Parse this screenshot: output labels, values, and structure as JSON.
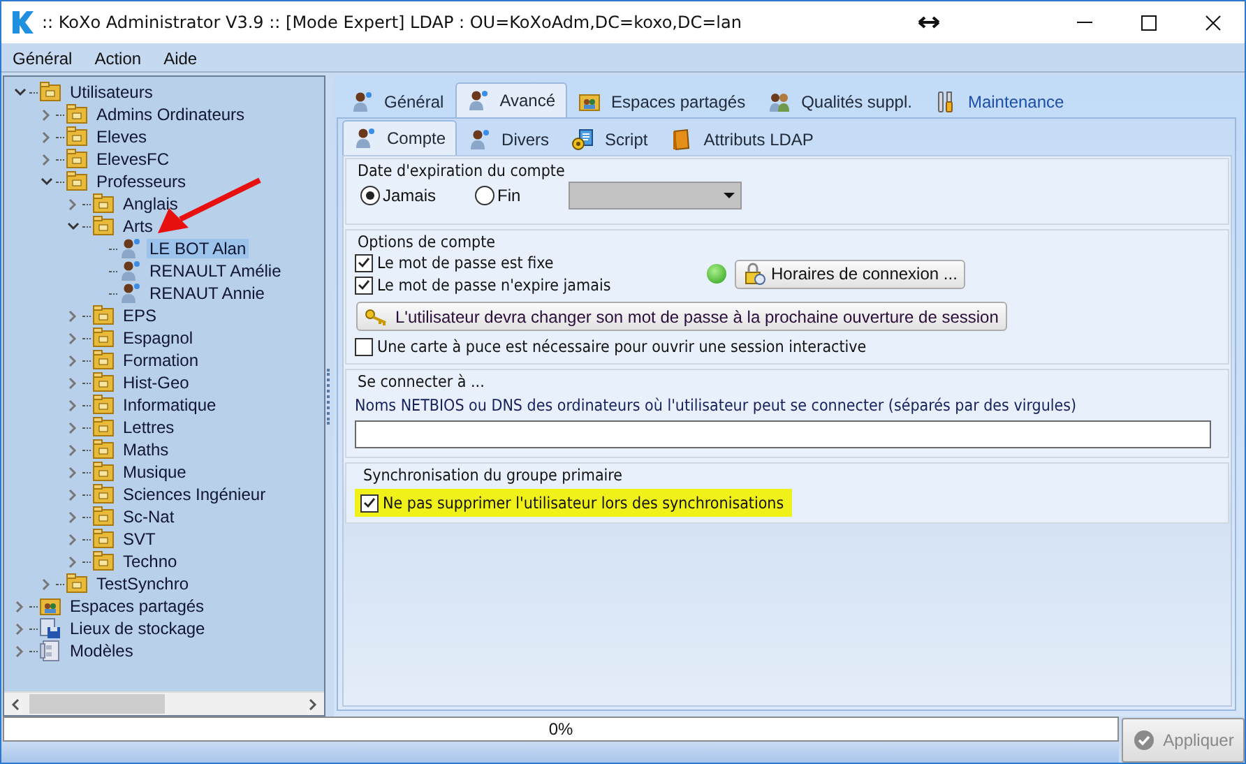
{
  "window": {
    "title": ":: KoXo Administrator V3.9 :: [Mode Expert] LDAP : OU=KoXoAdm,DC=koxo,DC=lan"
  },
  "menu": [
    "Général",
    "Action",
    "Aide"
  ],
  "tree": [
    {
      "label": "Utilisateurs",
      "kind": "folder",
      "expanded": true,
      "selected": false,
      "children": [
        {
          "label": "Admins Ordinateurs",
          "kind": "folder",
          "expanded": false,
          "selected": false
        },
        {
          "label": "Eleves",
          "kind": "folder",
          "expanded": false,
          "selected": false
        },
        {
          "label": "ElevesFC",
          "kind": "folder",
          "expanded": false,
          "selected": false
        },
        {
          "label": "Professeurs",
          "kind": "folder",
          "expanded": true,
          "selected": false,
          "children": [
            {
              "label": "Anglais",
              "kind": "folder",
              "expanded": false,
              "selected": false
            },
            {
              "label": "Arts",
              "kind": "folder",
              "expanded": true,
              "selected": false,
              "children": [
                {
                  "label": "LE BOT Alan",
                  "kind": "user",
                  "selected": true
                },
                {
                  "label": "RENAULT Amélie",
                  "kind": "user",
                  "selected": false
                },
                {
                  "label": "RENAUT Annie",
                  "kind": "user",
                  "selected": false
                }
              ]
            },
            {
              "label": "EPS",
              "kind": "folder",
              "expanded": false,
              "selected": false
            },
            {
              "label": "Espagnol",
              "kind": "folder",
              "expanded": false,
              "selected": false
            },
            {
              "label": "Formation",
              "kind": "folder",
              "expanded": false,
              "selected": false
            },
            {
              "label": "Hist-Geo",
              "kind": "folder",
              "expanded": false,
              "selected": false
            },
            {
              "label": "Informatique",
              "kind": "folder",
              "expanded": false,
              "selected": false
            },
            {
              "label": "Lettres",
              "kind": "folder",
              "expanded": false,
              "selected": false
            },
            {
              "label": "Maths",
              "kind": "folder",
              "expanded": false,
              "selected": false
            },
            {
              "label": "Musique",
              "kind": "folder",
              "expanded": false,
              "selected": false
            },
            {
              "label": "Sciences Ingénieur",
              "kind": "folder",
              "expanded": false,
              "selected": false
            },
            {
              "label": "Sc-Nat",
              "kind": "folder",
              "expanded": false,
              "selected": false
            },
            {
              "label": "SVT",
              "kind": "folder",
              "expanded": false,
              "selected": false
            },
            {
              "label": "Techno",
              "kind": "folder",
              "expanded": false,
              "selected": false
            }
          ]
        },
        {
          "label": "TestSynchro",
          "kind": "folder",
          "expanded": false,
          "selected": false
        }
      ]
    },
    {
      "label": "Espaces partagés",
      "kind": "share",
      "expanded": false,
      "selected": false
    },
    {
      "label": "Lieux de stockage",
      "kind": "storage",
      "expanded": false,
      "selected": false
    },
    {
      "label": "Modèles",
      "kind": "template",
      "expanded": false,
      "selected": false
    }
  ],
  "tabs": [
    {
      "label": "Général",
      "kind": "user",
      "selected": false,
      "hovered": false
    },
    {
      "label": "Avancé",
      "kind": "user",
      "selected": true,
      "hovered": false
    },
    {
      "label": "Espaces partagés",
      "kind": "share",
      "selected": false,
      "hovered": false
    },
    {
      "label": "Qualités suppl.",
      "kind": "users",
      "selected": false,
      "hovered": false
    },
    {
      "label": "Maintenance",
      "kind": "tools",
      "selected": false,
      "hovered": true
    }
  ],
  "subtabs": [
    {
      "label": "Compte",
      "kind": "user",
      "selected": true
    },
    {
      "label": "Divers",
      "kind": "user",
      "selected": false
    },
    {
      "label": "Script",
      "kind": "script",
      "selected": false
    },
    {
      "label": "Attributs LDAP",
      "kind": "book",
      "selected": false
    }
  ],
  "expiration": {
    "title": "Date d'expiration du compte",
    "options": [
      {
        "label": "Jamais",
        "selected": true
      },
      {
        "label": "Fin",
        "selected": false
      }
    ],
    "date_picker": {
      "disabled": true
    }
  },
  "account_options": {
    "title": "Options de compte",
    "checkboxes": [
      {
        "label": "Le mot de passe est fixe",
        "checked": true
      },
      {
        "label": "Le mot de passe n'expire jamais",
        "checked": true
      }
    ],
    "status": {
      "on": true
    },
    "schedule_button": "Horaires de connexion ...",
    "change_password_button": "L'utilisateur devra changer son mot de passe à la prochaine ouverture de session",
    "smartcard": {
      "label": "Une carte à puce est nécessaire pour ouvrir une session interactive",
      "checked": false
    }
  },
  "connect_to": {
    "title": "Se connecter à ...",
    "label": "Noms NETBIOS ou DNS des ordinateurs où l'utilisateur peut se connecter (séparés par des virgules)"
  },
  "sync": {
    "title": "Synchronisation du groupe primaire",
    "checkbox": {
      "label": "Ne pas supprimer l'utilisateur lors des synchronisations",
      "checked": true,
      "highlighted": true
    }
  },
  "progress": {
    "level": 0,
    "reading": "0%"
  },
  "apply_button": {
    "label": "Appliquer",
    "disabled": true
  }
}
